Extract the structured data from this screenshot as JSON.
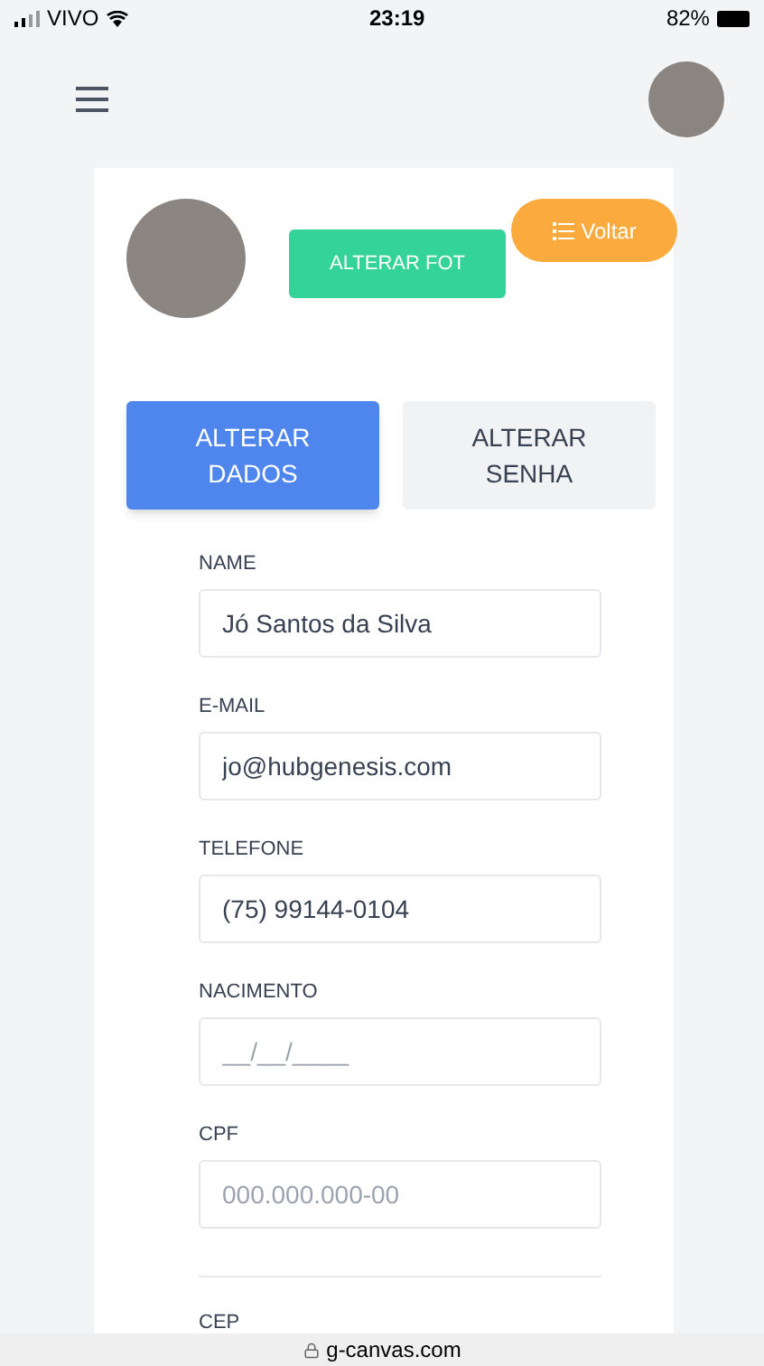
{
  "status_bar": {
    "carrier": "VIVO",
    "time": "23:19",
    "battery": "82%"
  },
  "profile": {
    "change_photo_button": "ALTERAR FOT",
    "back_button": "Voltar"
  },
  "tabs": [
    {
      "label": "ALTERAR DADOS",
      "selected": true
    },
    {
      "label": "ALTERAR SENHA",
      "selected": false
    }
  ],
  "fields": [
    {
      "label": "NAME",
      "value": "Jó Santos da Silva"
    },
    {
      "label": "E-MAIL",
      "value": "jo@hubgenesis.com"
    },
    {
      "label": "TELEFONE",
      "value": "(75) 99144-0104"
    },
    {
      "label": "NACIMENTO",
      "placeholder": "__/__/____"
    },
    {
      "label": "CPF",
      "placeholder": "000.000.000-00"
    }
  ],
  "next_section_label": "CEP",
  "address_bar": "g-canvas.com"
}
